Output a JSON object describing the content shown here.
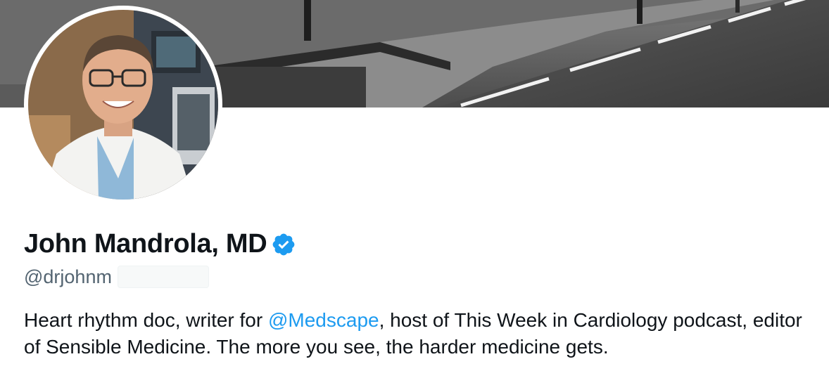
{
  "profile": {
    "display_name": "John Mandrola, MD",
    "verified": true,
    "handle": "@drjohnm",
    "bio": {
      "before_mention": "Heart rhythm doc, writer for ",
      "mention": "@Medscape",
      "after_mention": ", host of This Week in Cardiology podcast, editor of Sensible Medicine. The more you see, the harder medicine gets."
    }
  },
  "icons": {
    "verified": "verified-badge-icon"
  },
  "colors": {
    "text": "#0f1419",
    "secondary_text": "#536471",
    "link": "#1d9bf0",
    "verified": "#1d9bf0",
    "background": "#ffffff"
  }
}
